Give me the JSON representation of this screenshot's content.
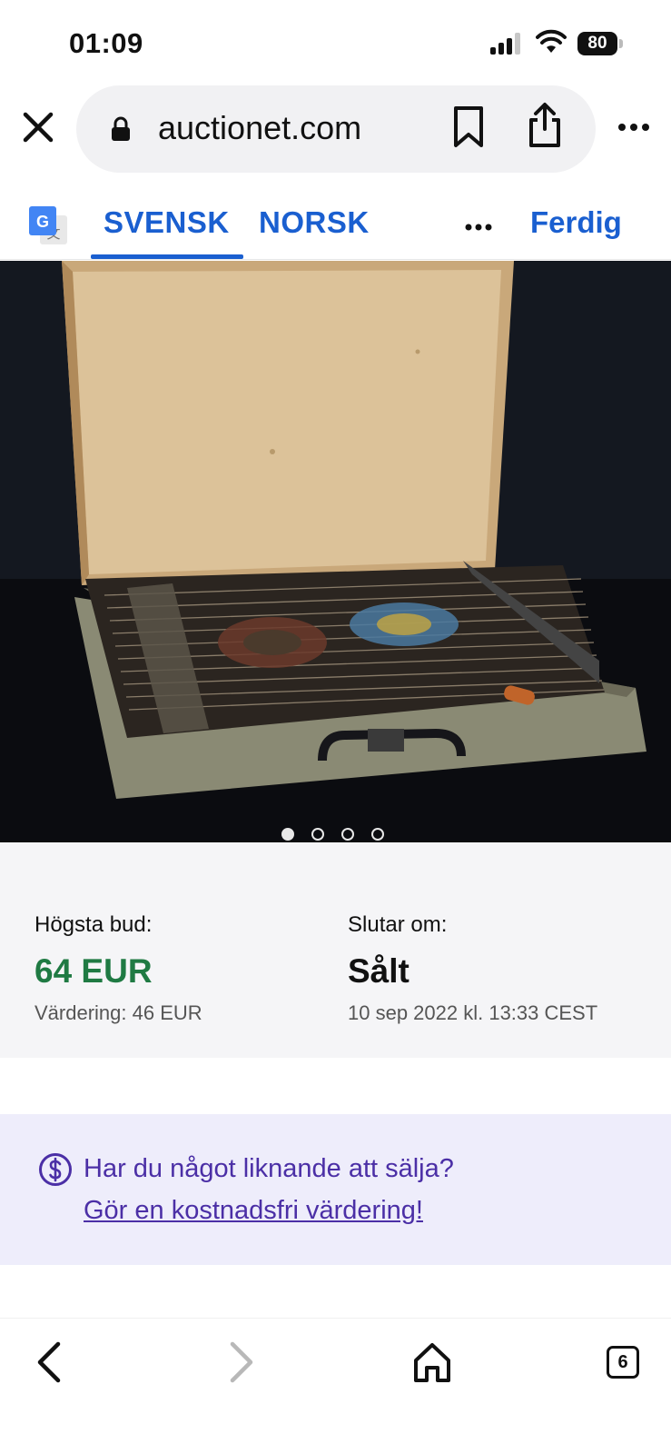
{
  "status_bar": {
    "time": "01:09",
    "battery": "80"
  },
  "browser": {
    "url": "auctionet.com",
    "icons": [
      "close-icon",
      "lock-icon",
      "bookmark-icon",
      "share-icon",
      "more-icon"
    ]
  },
  "translate_bar": {
    "tabs": [
      {
        "label": "SVENSK",
        "selected": true
      },
      {
        "label": "NORSK",
        "selected": false
      }
    ],
    "done_label": "Ferdig"
  },
  "gallery": {
    "image_count": 4,
    "active_index": 0
  },
  "bid": {
    "highest_bid_label": "Högsta bud:",
    "highest_bid_value": "64 EUR",
    "estimate": "Värdering: 46 EUR",
    "ends_label": "Slutar om:",
    "status": "Sålt",
    "end_date": "10 sep 2022 kl. 13:33 CEST"
  },
  "sell_banner": {
    "question": "Har du något liknande att sälja?",
    "link": "Gör en kostnadsfri värdering!"
  },
  "toolbar": {
    "tabs_count": "6"
  },
  "colors": {
    "accent_blue": "#1a5fd0",
    "bid_green": "#1f7a43",
    "banner_purple": "#4b2fa6",
    "banner_bg": "#eeedfb"
  }
}
